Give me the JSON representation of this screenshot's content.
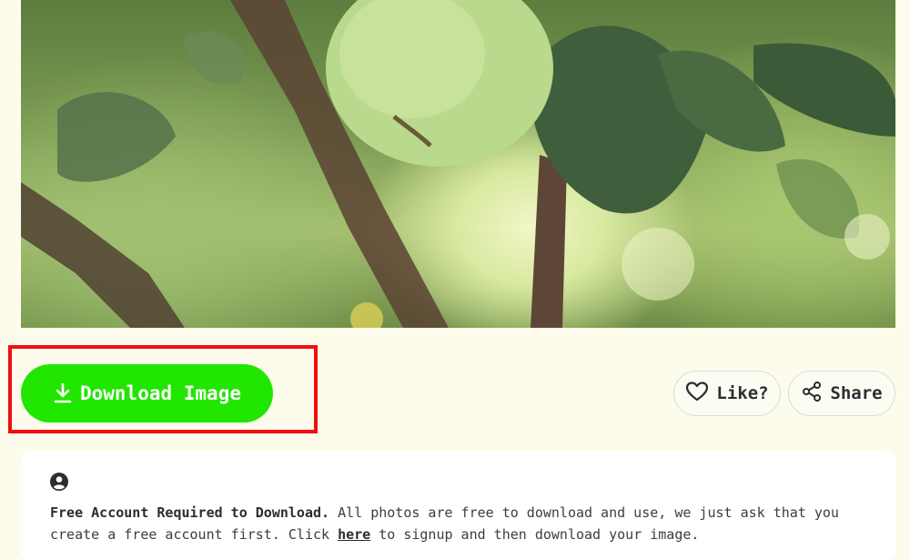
{
  "photo": {
    "alt": "green apple on tree branch"
  },
  "actions": {
    "download_label": "Download Image",
    "like_label": "Like?",
    "share_label": "Share"
  },
  "notice": {
    "title": "Free Account Required to Download.",
    "text_before": " All photos are free to download and use, we just ask that you create a free account first. Click ",
    "link_label": "here",
    "text_after": " to signup and then download your image."
  },
  "colors": {
    "download_button": "#20e600",
    "highlight": "#f00e0e",
    "background": "#fdfcec"
  },
  "icons": [
    "download-icon",
    "heart-icon",
    "share-icon",
    "account-icon"
  ]
}
